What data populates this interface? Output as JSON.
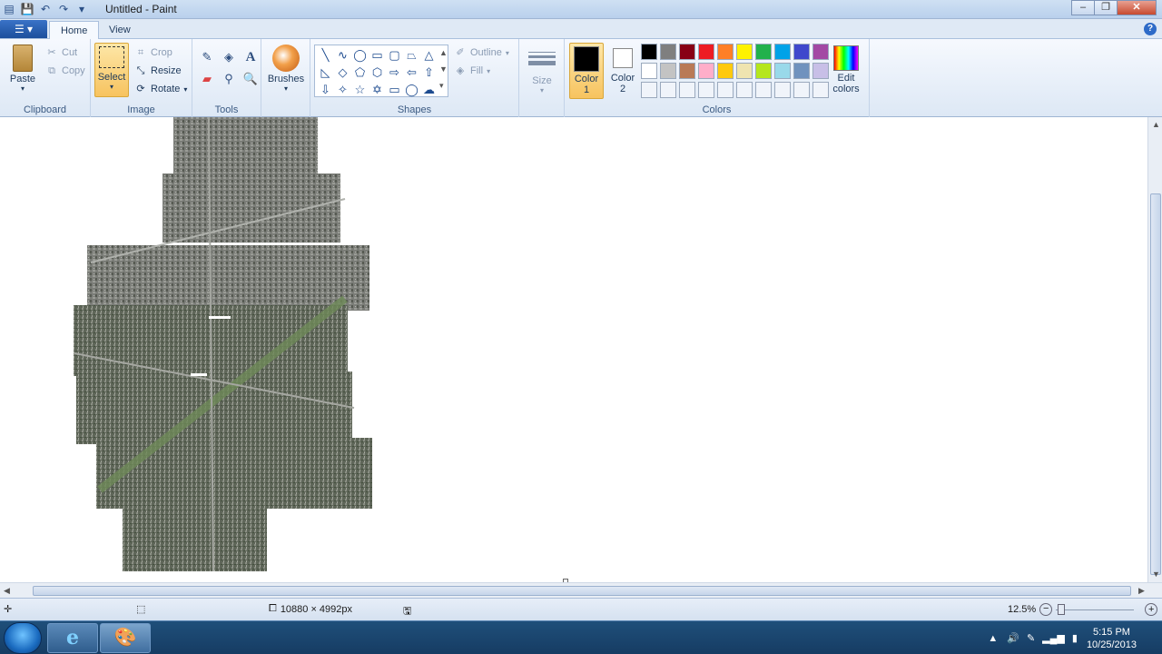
{
  "window": {
    "title": "Untitled - Paint"
  },
  "tabs": [
    {
      "label": "Home"
    },
    {
      "label": "View"
    }
  ],
  "clipboard": {
    "paste": "Paste",
    "cut": "Cut",
    "copy": "Copy",
    "label": "Clipboard"
  },
  "image": {
    "select": "Select",
    "crop": "Crop",
    "resize": "Resize",
    "rotate": "Rotate",
    "label": "Image"
  },
  "tools": {
    "label": "Tools"
  },
  "brushes": {
    "label": "Brushes"
  },
  "shapes": {
    "outline": "Outline",
    "fill": "Fill",
    "label": "Shapes"
  },
  "size": {
    "label": "Size"
  },
  "colors": {
    "color1": "Color\n1",
    "color1_l1": "Color",
    "color1_l2": "1",
    "color2_l1": "Color",
    "color2_l2": "2",
    "edit_l1": "Edit",
    "edit_l2": "colors",
    "label": "Colors",
    "palette_row1": [
      "#000000",
      "#7f7f7f",
      "#880015",
      "#ed1c24",
      "#ff7f27",
      "#fff200",
      "#22b14c",
      "#00a2e8",
      "#3f48cc",
      "#a349a4"
    ],
    "palette_row2": [
      "#ffffff",
      "#c3c3c3",
      "#b97a57",
      "#ffaec9",
      "#ffc90e",
      "#efe4b0",
      "#b5e61d",
      "#99d9ea",
      "#7092be",
      "#c8bfe7"
    ],
    "palette_row3": [
      "#f0f4fa",
      "#f0f4fa",
      "#f0f4fa",
      "#f0f4fa",
      "#f0f4fa",
      "#f0f4fa",
      "#f0f4fa",
      "#f0f4fa",
      "#f0f4fa",
      "#f0f4fa"
    ]
  },
  "status": {
    "dimensions": "10880 × 4992px",
    "zoom": "12.5%"
  },
  "taskbar": {
    "time": "5:15 PM",
    "date": "10/25/2013"
  }
}
